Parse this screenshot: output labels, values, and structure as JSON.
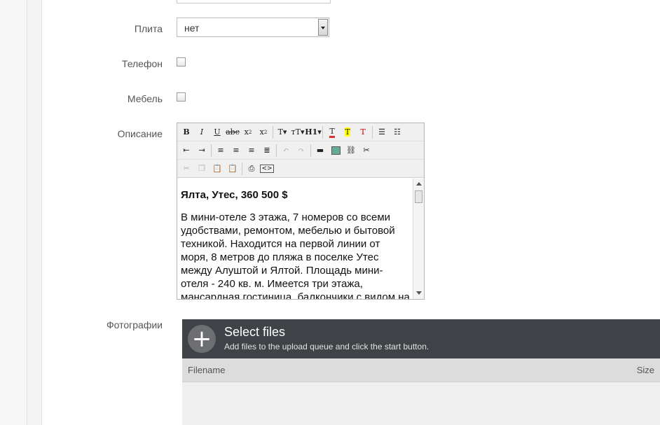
{
  "fields": {
    "stove": {
      "label": "Плита",
      "value": "нет"
    },
    "phone": {
      "label": "Телефон"
    },
    "furniture": {
      "label": "Мебель"
    },
    "description": {
      "label": "Описание"
    },
    "photos": {
      "label": "Фотографии"
    }
  },
  "editor": {
    "toolbar_row1": [
      "bold-icon",
      "italic-icon",
      "underline-icon",
      "strikethrough-icon",
      "subscript-icon",
      "superscript-icon",
      "font-icon",
      "font-size-icon",
      "heading-icon",
      "text-color-icon",
      "highlight-icon",
      "clear-format-icon",
      "bullet-list-icon",
      "numbered-list-icon"
    ],
    "toolbar_row2": [
      "outdent-icon",
      "indent-icon",
      "align-left-icon",
      "align-center-icon",
      "align-right-icon",
      "justify-icon",
      "undo-icon",
      "redo-icon",
      "horizontal-rule-icon",
      "image-icon",
      "link-icon",
      "unlink-icon"
    ],
    "toolbar_row3": [
      "cut-icon",
      "copy-icon",
      "paste-icon",
      "paste-text-icon",
      "print-icon",
      "source-code-icon"
    ],
    "heading": "Ялта, Утес, 360 500 $",
    "body": " В мини-отеле 3 этажа, 7 номеров со всеми удобствами, ремонтом, мебелью и бытовой техникой. Находится на первой линии от моря, 8 метров до пляжа в поселке Утес между Алуштой и Ялтой. Площадь мини-отеля - 240 кв. м. Имеется три этажа, мансардная гостиница, балкончики с видом на"
  },
  "uploader": {
    "title": "Select files",
    "subtitle": "Add files to the upload queue and click the start button.",
    "col_filename": "Filename",
    "col_size": "Size"
  }
}
